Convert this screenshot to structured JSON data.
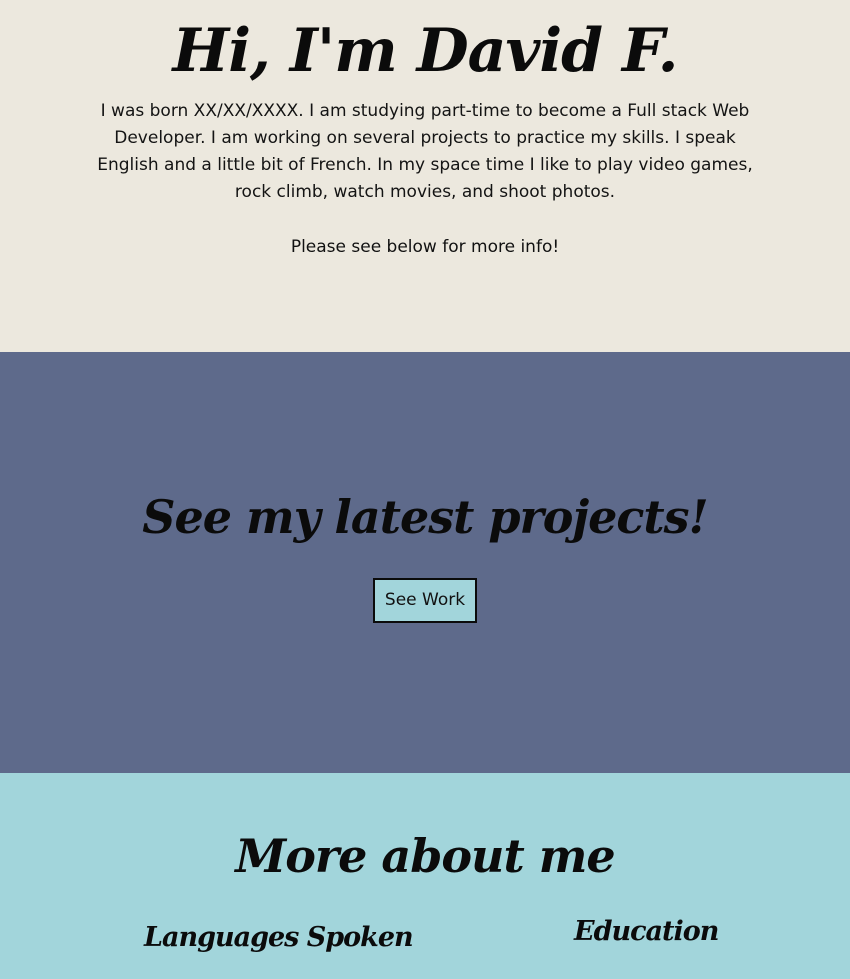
{
  "hero": {
    "title": "Hi, I'm David F.",
    "bio": "I was born XX/XX/XXXX. I am studying part-time to become a Full stack Web Developer. I am working on several projects to practice my skills. I speak English and a little bit of French. In my space time I like to play video games, rock climb, watch movies, and shoot photos.",
    "cta_text": "Please see below for more info!"
  },
  "projects": {
    "title": "See my latest projects!",
    "button_label": "See Work"
  },
  "about": {
    "title": "More about me",
    "languages_heading": "Languages Spoken",
    "education_heading": "Education"
  },
  "colors": {
    "hero_bg": "#ece8de",
    "projects_bg": "#5e6a8b",
    "about_bg": "#a2d5db",
    "button_bg": "#a2d5db",
    "text": "#0b0b0b"
  }
}
